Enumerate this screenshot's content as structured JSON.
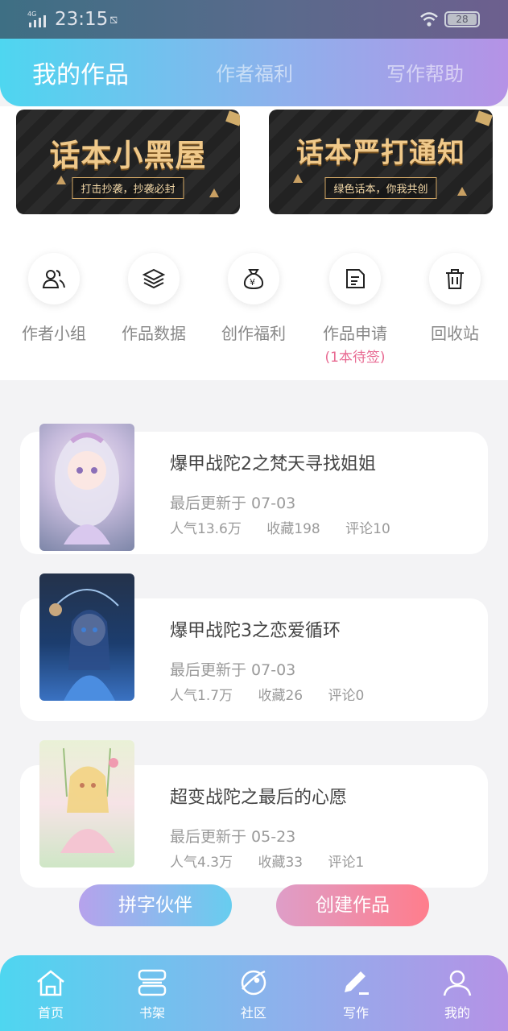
{
  "status_bar": {
    "network": "4G HD",
    "time": "23:15",
    "battery": "28"
  },
  "top_tabs": [
    {
      "label": "我的作品",
      "active": true
    },
    {
      "label": "作者福利",
      "active": false
    },
    {
      "label": "写作帮助",
      "active": false
    }
  ],
  "banners": [
    {
      "title": "话本小黑屋",
      "subtitle": "打击抄袭，抄袭必封"
    },
    {
      "title": "话本严打通知",
      "subtitle": "绿色话本，你我共创"
    }
  ],
  "features": [
    {
      "label": "作者小组",
      "icon": "users-icon"
    },
    {
      "label": "作品数据",
      "icon": "layers-icon"
    },
    {
      "label": "创作福利",
      "icon": "money-bag-icon"
    },
    {
      "label": "作品申请",
      "sublabel": "(1本待签)",
      "icon": "document-icon"
    },
    {
      "label": "回收站",
      "icon": "trash-icon"
    }
  ],
  "works": [
    {
      "title": "爆甲战陀2之梵天寻找姐姐",
      "updated": "最后更新于 07-03",
      "popularity": "人气13.6万",
      "favorites": "收藏198",
      "comments": "评论10"
    },
    {
      "title": "爆甲战陀3之恋爱循环",
      "updated": "最后更新于 07-03",
      "popularity": "人气1.7万",
      "favorites": "收藏26",
      "comments": "评论0"
    },
    {
      "title": "超变战陀之最后的心愿",
      "updated": "最后更新于 05-23",
      "popularity": "人气4.3万",
      "favorites": "收藏33",
      "comments": "评论1"
    }
  ],
  "actions": {
    "partner": "拼字伙伴",
    "create": "创建作品"
  },
  "bottom_nav": [
    {
      "label": "首页",
      "icon": "home-icon"
    },
    {
      "label": "书架",
      "icon": "bookshelf-icon"
    },
    {
      "label": "社区",
      "icon": "planet-icon"
    },
    {
      "label": "写作",
      "icon": "pen-icon"
    },
    {
      "label": "我的",
      "icon": "profile-icon"
    }
  ],
  "colors": {
    "accent_start": "#4ed6f0",
    "accent_end": "#b592e6",
    "pending": "#e86a92",
    "create_button": "#ff7d8c"
  }
}
